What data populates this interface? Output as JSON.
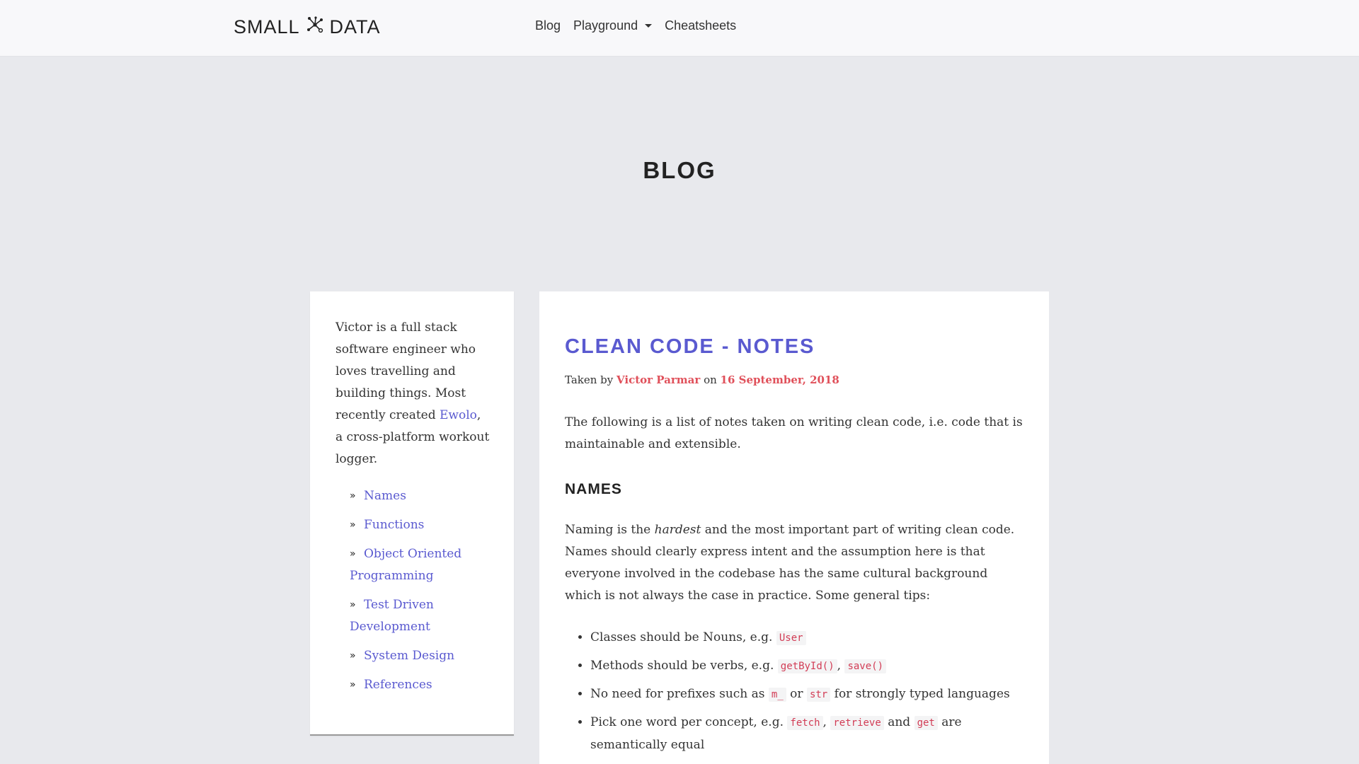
{
  "header": {
    "brand_left": "SMALL",
    "brand_right": "DATA",
    "brand_icon": "molecule-icon",
    "nav": {
      "blog": "Blog",
      "playground": "Playground",
      "cheatsheets": "Cheatsheets"
    }
  },
  "hero": {
    "title": "BLOG"
  },
  "sidebar": {
    "bio_prefix": "Victor is a full stack software engineer who loves travelling and building things. Most recently created ",
    "bio_link": "Ewolo",
    "bio_suffix": ", a cross-platform workout logger.",
    "toc": [
      "Names",
      "Functions",
      "Object Oriented Programming",
      "Test Driven Development",
      "System Design",
      "References"
    ]
  },
  "post": {
    "title": "CLEAN CODE - NOTES",
    "meta_taken_by": "Taken by ",
    "author": "Victor Parmar",
    "meta_on": " on ",
    "date": "16 September, 2018",
    "intro": "The following is a list of notes taken on writing clean code, i.e. code that is maintainable and extensible.",
    "section_names": "NAMES",
    "names_p1": "Naming is the ",
    "names_em": "hardest",
    "names_p2": " and the most important part of writing clean code. Names should clearly express intent and the assumption here is that everyone involved in the codebase has the same cultural background which is not always the case in practice. Some general tips:",
    "tips": {
      "t1_text": "Classes should be Nouns, e.g. ",
      "t1_code": "User",
      "t2_text": "Methods should be verbs, e.g. ",
      "t2_code1": "getById()",
      "t2_sep": ", ",
      "t2_code2": "save()",
      "t3_text": "No need for prefixes such as ",
      "t3_code1": "m_",
      "t3_or": " or ",
      "t3_code2": "str",
      "t3_tail": " for strongly typed languages",
      "t4_text": "Pick one word per concept, e.g. ",
      "t4_code1": "fetch",
      "t4_sep": ", ",
      "t4_code2": "retrieve",
      "t4_and": " and ",
      "t4_code3": "get",
      "t4_tail": " are semantically equal"
    }
  },
  "colors": {
    "accent": "#5a5ad0",
    "author_red": "#e0505a",
    "code_red": "#d23c55",
    "background": "#e8e9ed"
  }
}
